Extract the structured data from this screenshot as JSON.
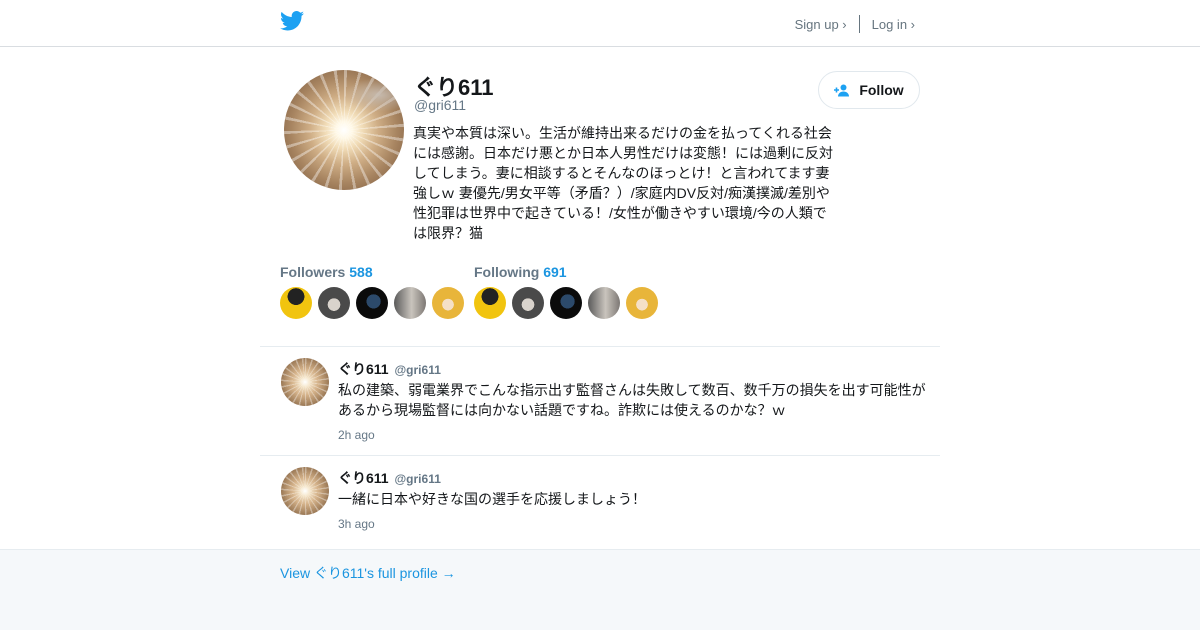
{
  "header": {
    "logo_icon": "twitter-bird-icon",
    "signup_label": "Sign up ›",
    "login_label": "Log in ›",
    "brand_color": "#1da1f2"
  },
  "profile": {
    "display_name": "ぐり611",
    "handle": "@gri611",
    "follow_label": "Follow",
    "follow_icon": "add-user-icon",
    "bio": "真実や本質は深い。生活が維持出来るだけの金を払ってくれる社会には感謝。日本だけ悪とか日本人男性だけは変態！には過剰に反対してしまう。妻に相談するとそんなのほっとけ！と言われてます妻強しｗ 妻優先/男女平等（矛盾？）/家庭内DV反対/痴漢撲滅/差別や性犯罪は世界中で起きている！/女性が働きやすい環境/今の人類では限界？猫"
  },
  "followers": {
    "label": "Followers",
    "count": "588"
  },
  "following": {
    "label": "Following",
    "count": "691"
  },
  "tweets": [
    {
      "name": "ぐり611",
      "handle": "@gri611",
      "text": "私の建築、弱電業界でこんな指示出す監督さんは失敗して数百、数千万の損失を出す可能性があるから現場監督には向かない話題ですね。詐欺には使えるのかな？ｗ",
      "time": "2h ago"
    },
    {
      "name": "ぐり611",
      "handle": "@gri611",
      "text": "一緒に日本や好きな国の選手を応援しましょう！",
      "time": "3h ago"
    }
  ],
  "footer": {
    "link_label": "View ぐり611's full profile →"
  },
  "colors": {
    "link": "#1b95e0",
    "muted": "#657786",
    "footer_bg": "#f5f8fa"
  }
}
